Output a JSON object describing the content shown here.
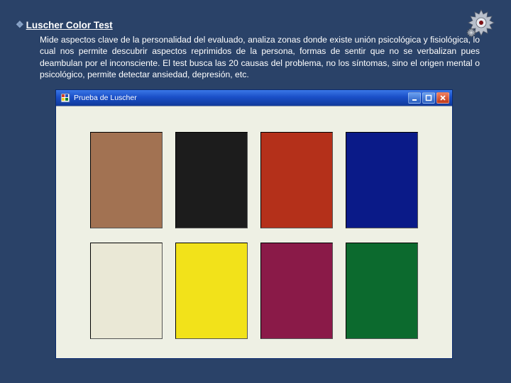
{
  "heading": {
    "bullet": "❖",
    "title": "Luscher Color Test"
  },
  "description": "Mide aspectos clave de la personalidad del evaluado, analiza zonas donde existe unión psicológica y fisiológica, lo cual nos permite descubrir aspectos reprimidos de la persona, formas de sentir que no se verbalizan pues deambulan por el inconsciente. El test busca las 20 causas del problema, no los síntomas, sino el origen mental o psicológico, permite detectar ansiedad, depresión, etc.",
  "window": {
    "title": "Prueba de Luscher",
    "swatches": [
      {
        "name": "brown",
        "hex": "#a27252"
      },
      {
        "name": "black",
        "hex": "#1c1c1c"
      },
      {
        "name": "red",
        "hex": "#b4301a"
      },
      {
        "name": "blue",
        "hex": "#0a1a88"
      },
      {
        "name": "grey",
        "hex": "#eae8d6"
      },
      {
        "name": "yellow",
        "hex": "#f2e21a"
      },
      {
        "name": "violet",
        "hex": "#8a1a48"
      },
      {
        "name": "green",
        "hex": "#0c6a2e"
      }
    ]
  }
}
